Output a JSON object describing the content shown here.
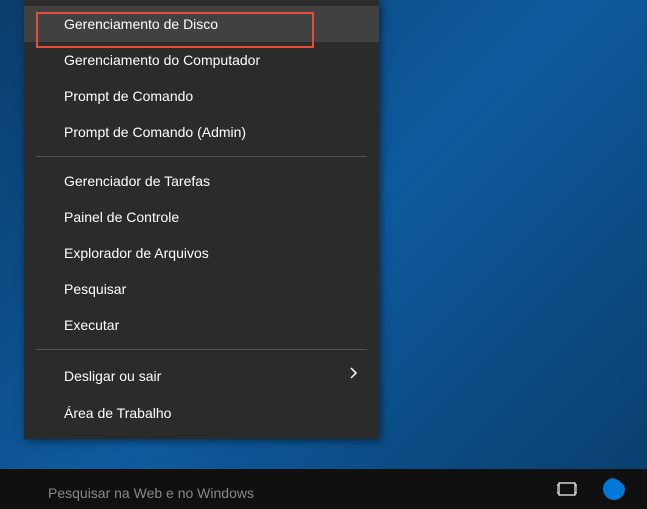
{
  "menu": {
    "items": [
      {
        "label": "Gerenciamento de Disco",
        "highlighted": true
      },
      {
        "label": "Gerenciamento do Computador"
      },
      {
        "label": "Prompt de Comando"
      },
      {
        "label": "Prompt de Comando (Admin)"
      },
      {
        "separator": true
      },
      {
        "label": "Gerenciador de Tarefas"
      },
      {
        "label": "Painel de Controle"
      },
      {
        "label": "Explorador de Arquivos"
      },
      {
        "label": "Pesquisar"
      },
      {
        "label": "Executar"
      },
      {
        "separator": true
      },
      {
        "label": "Desligar ou sair",
        "submenu": true
      },
      {
        "label": "Área de Trabalho"
      }
    ]
  },
  "taskbar": {
    "search_placeholder": "Pesquisar na Web e no Windows"
  },
  "colors": {
    "highlight_border": "#e74c3c",
    "menu_bg": "#2b2b2b",
    "menu_hover": "#414141"
  }
}
